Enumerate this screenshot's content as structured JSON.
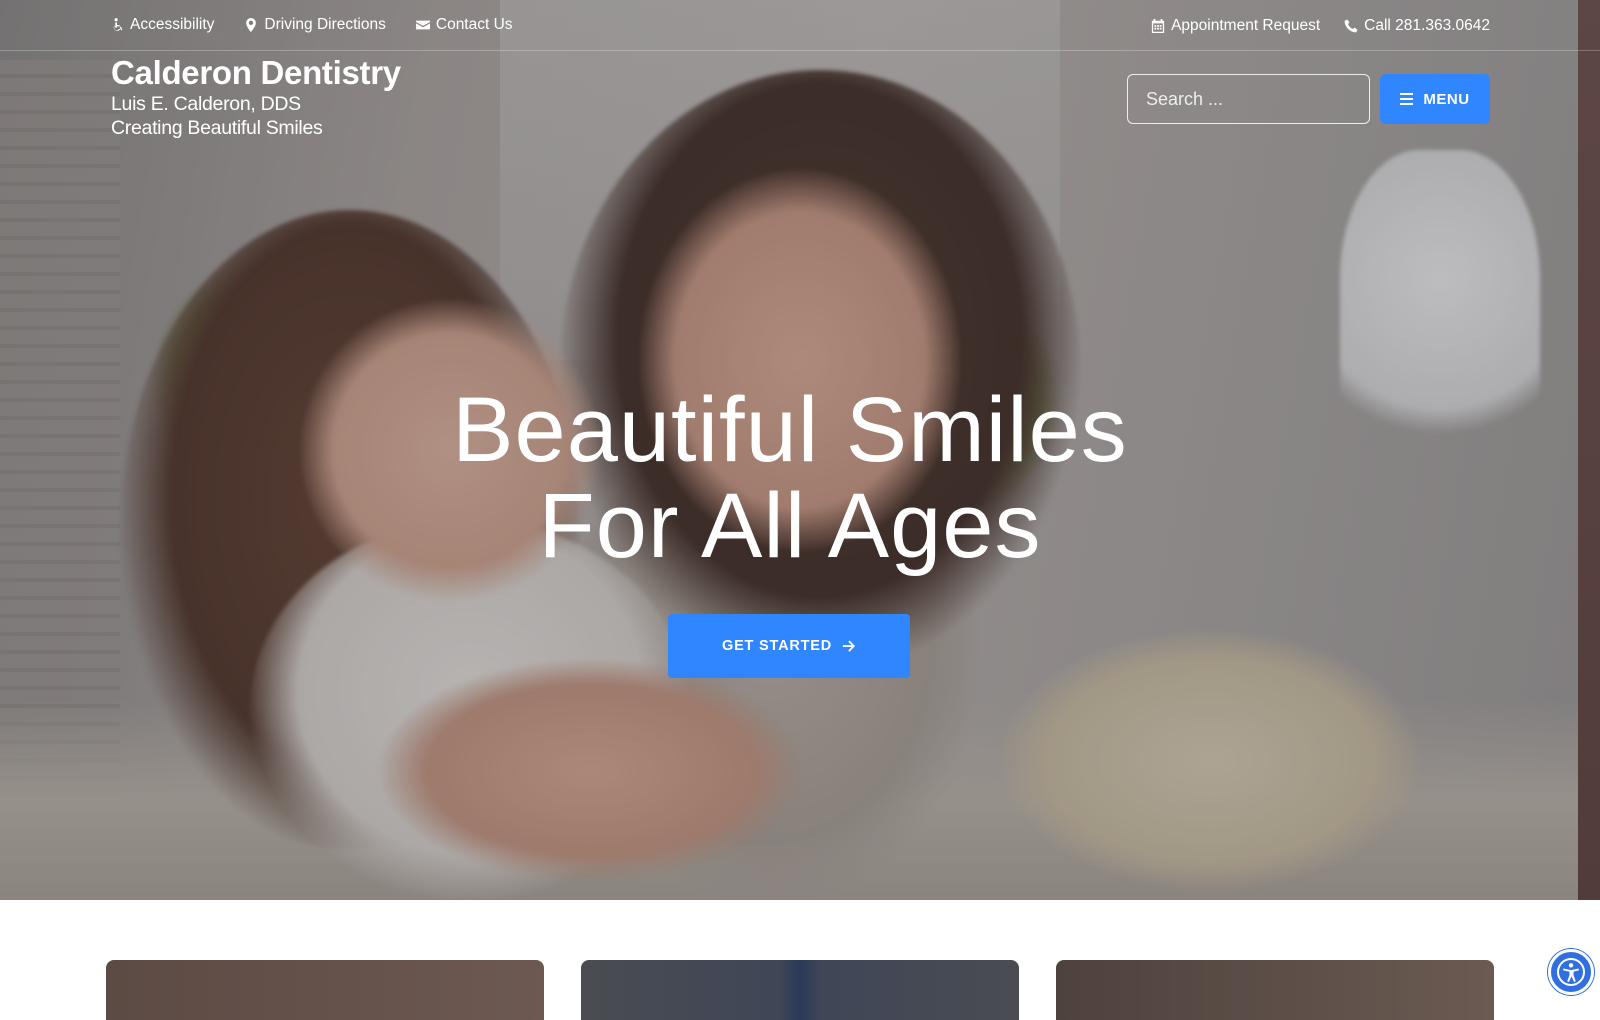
{
  "utility": {
    "left_links": [
      {
        "label": "Accessibility",
        "icon": "wheelchair-icon"
      },
      {
        "label": "Driving Directions",
        "icon": "map-marker-icon"
      },
      {
        "label": "Contact Us",
        "icon": "envelope-icon"
      }
    ],
    "right_links": [
      {
        "label": "Appointment Request",
        "icon": "calendar-icon"
      },
      {
        "label": "Call 281.363.0642",
        "icon": "phone-icon"
      }
    ]
  },
  "brand": {
    "name": "Calderon Dentistry",
    "doctor": "Luis E. Calderon, DDS",
    "tagline": "Creating Beautiful Smiles"
  },
  "search": {
    "placeholder": "Search ...",
    "button_icon": "search-icon"
  },
  "menu": {
    "label": "MENU",
    "icon": "hamburger-icon"
  },
  "hero": {
    "headline_line1": "Beautiful Smiles",
    "headline_line2": "For All Ages",
    "cta_label": "GET STARTED",
    "cta_icon": "arrow-right-icon"
  },
  "accessibility_widget": {
    "icon": "accessibility-person-icon"
  },
  "colors": {
    "accent": "#2f86ff",
    "widget": "#2f6fe0",
    "text_on_hero": "#ffffff"
  }
}
